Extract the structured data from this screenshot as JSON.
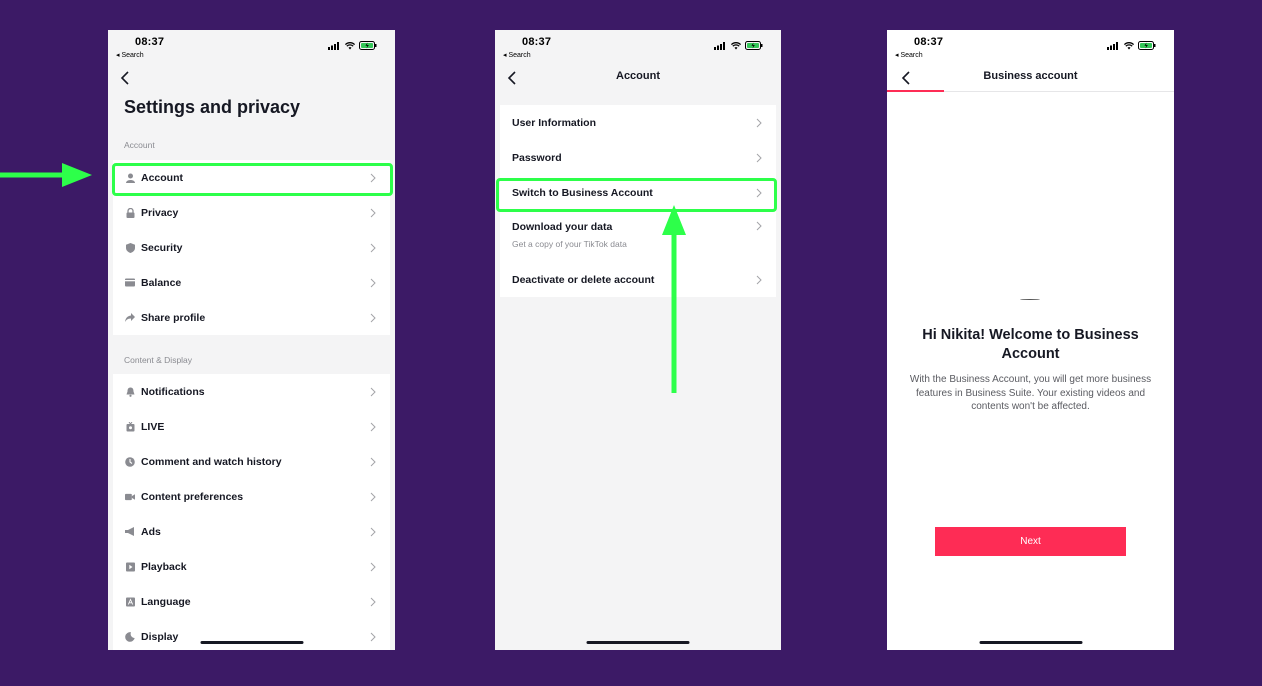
{
  "status_bar": {
    "time": "08:37",
    "back_app": "◂ Search"
  },
  "screen1": {
    "title": "Settings and privacy",
    "section_account": "Account",
    "account_items": [
      {
        "label": "Account",
        "icon": "person-icon"
      },
      {
        "label": "Privacy",
        "icon": "lock-icon"
      },
      {
        "label": "Security",
        "icon": "shield-icon"
      },
      {
        "label": "Balance",
        "icon": "wallet-icon"
      },
      {
        "label": "Share profile",
        "icon": "share-icon"
      }
    ],
    "section_content": "Content & Display",
    "content_items": [
      {
        "label": "Notifications",
        "icon": "bell-icon"
      },
      {
        "label": "LIVE",
        "icon": "live-icon"
      },
      {
        "label": "Comment and watch history",
        "icon": "clock-icon"
      },
      {
        "label": "Content preferences",
        "icon": "video-icon"
      },
      {
        "label": "Ads",
        "icon": "megaphone-icon"
      },
      {
        "label": "Playback",
        "icon": "play-icon"
      },
      {
        "label": "Language",
        "icon": "language-icon"
      },
      {
        "label": "Display",
        "icon": "moon-icon"
      }
    ]
  },
  "screen2": {
    "title": "Account",
    "items": [
      {
        "label": "User Information"
      },
      {
        "label": "Password"
      },
      {
        "label": "Switch to Business Account"
      },
      {
        "label": "Download your data",
        "sub": "Get a copy of your TikTok data"
      },
      {
        "label": "Deactivate or delete account"
      }
    ]
  },
  "screen3": {
    "title": "Business account",
    "welcome_title": "Hi Nikita! Welcome to Business Account",
    "welcome_desc": "With the Business Account, you will get more business features in Business Suite. Your existing videos and contents won't be affected.",
    "next_label": "Next"
  },
  "colors": {
    "background": "#3c1a66",
    "highlight": "#2dff4a",
    "accent": "#fe2c55"
  }
}
